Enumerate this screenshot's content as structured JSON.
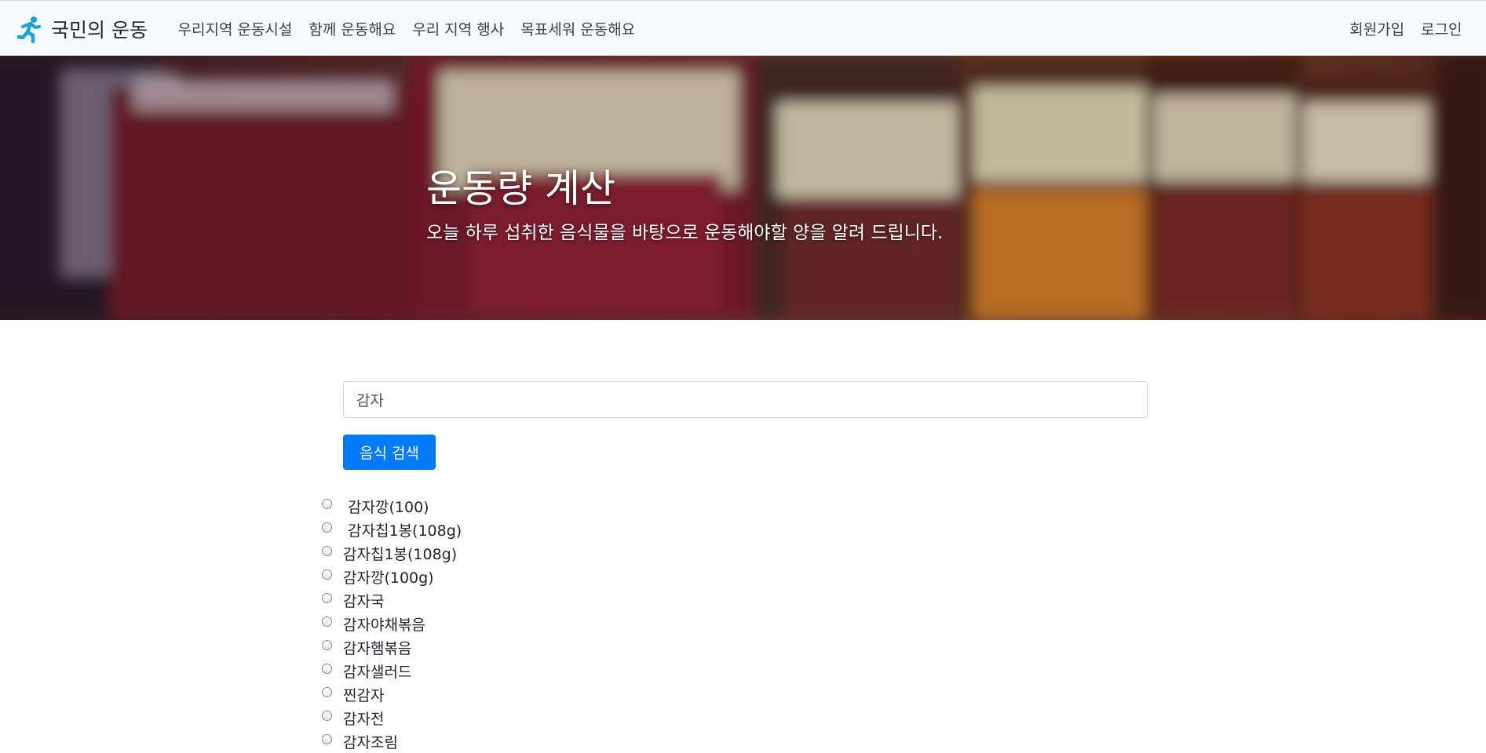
{
  "navbar": {
    "brand_icon": "runner-icon",
    "brand_text": "국민의 운동",
    "left_links": [
      {
        "label": "우리지역 운동시설"
      },
      {
        "label": "함께 운동해요"
      },
      {
        "label": "우리 지역 행사"
      },
      {
        "label": "목표세워 운동해요"
      }
    ],
    "right_links": [
      {
        "label": "회원가입"
      },
      {
        "label": "로그인"
      }
    ]
  },
  "hero": {
    "title": "운동량 계산",
    "subtitle": "오늘 하루 섭취한 음식물을 바탕으로 운동해야할 양을 알려 드립니다."
  },
  "search": {
    "value": "감자",
    "button_label": "음식 검색"
  },
  "results": [
    {
      "label": " 감자깡(100)",
      "selected": false
    },
    {
      "label": " 감자칩1봉(108g)",
      "selected": false
    },
    {
      "label": "감자칩1봉(108g)",
      "selected": false
    },
    {
      "label": "감자깡(100g)",
      "selected": false
    },
    {
      "label": "감자국",
      "selected": false
    },
    {
      "label": "감자야채볶음",
      "selected": false
    },
    {
      "label": "감자햄볶음",
      "selected": false
    },
    {
      "label": "감자샐러드",
      "selected": false
    },
    {
      "label": "찐감자",
      "selected": false
    },
    {
      "label": "감자전",
      "selected": false
    },
    {
      "label": "감자조림",
      "selected": false
    }
  ],
  "colors": {
    "navbar_bg": "#f8f9fa",
    "primary": "#007bff",
    "brand_icon": "#17a2d8"
  }
}
